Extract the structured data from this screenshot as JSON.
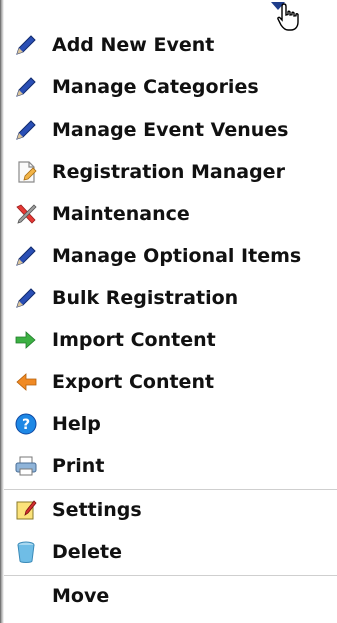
{
  "menu": {
    "items": [
      {
        "label": "Add New Event",
        "icon": "pencil-icon"
      },
      {
        "label": "Manage Categories",
        "icon": "pencil-icon"
      },
      {
        "label": "Manage Event Venues",
        "icon": "pencil-icon"
      },
      {
        "label": "Registration Manager",
        "icon": "document-edit-icon"
      },
      {
        "label": "Maintenance",
        "icon": "tools-icon"
      },
      {
        "label": "Manage Optional Items",
        "icon": "pencil-icon"
      },
      {
        "label": "Bulk Registration",
        "icon": "pencil-icon"
      },
      {
        "label": "Import Content",
        "icon": "arrow-right-icon"
      },
      {
        "label": "Export Content",
        "icon": "arrow-left-icon"
      },
      {
        "label": "Help",
        "icon": "help-icon"
      },
      {
        "label": "Print",
        "icon": "print-icon"
      },
      {
        "label": "Settings",
        "icon": "settings-icon"
      },
      {
        "label": "Delete",
        "icon": "trash-icon"
      },
      {
        "label": "Move",
        "icon": ""
      }
    ]
  },
  "colors": {
    "pencil_blue": "#2a4fb5",
    "arrow_green": "#3cb043",
    "arrow_orange": "#f08a24",
    "help_blue": "#1e88e5",
    "tools_red": "#e53935"
  }
}
